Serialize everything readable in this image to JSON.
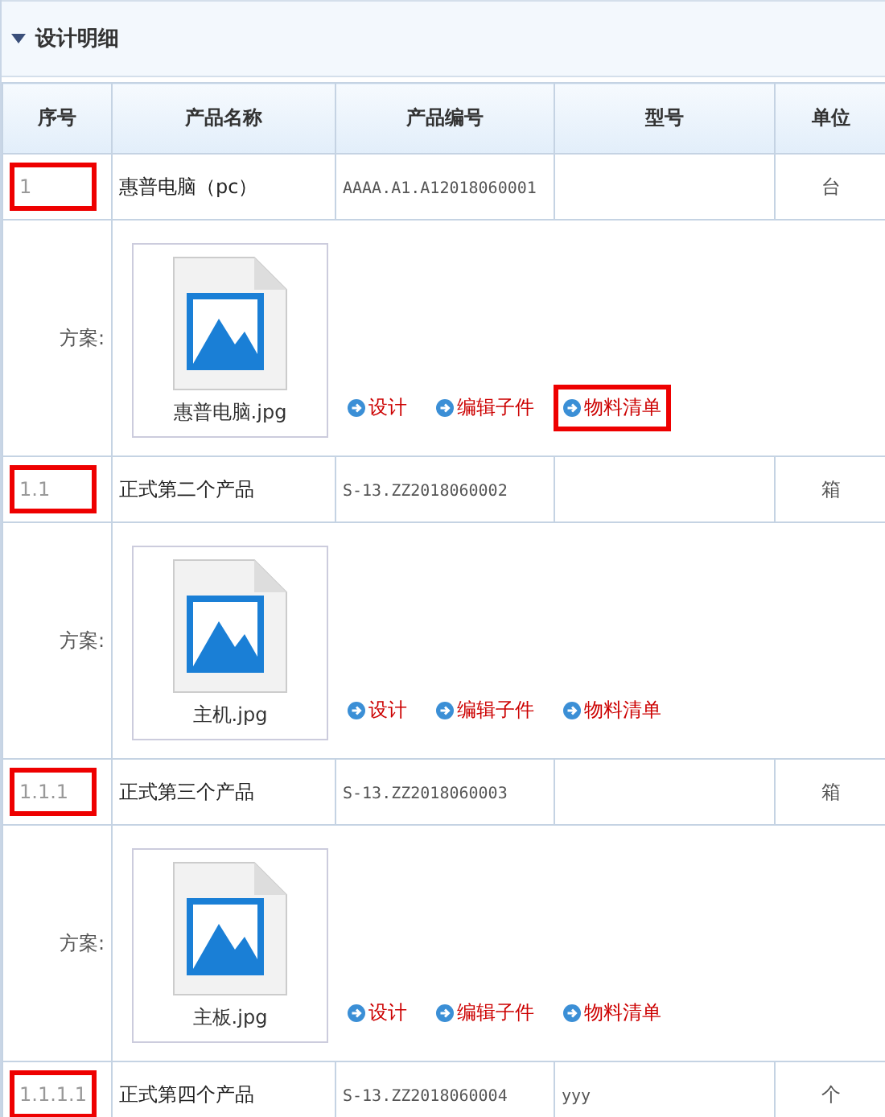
{
  "section": {
    "title": "设计明细",
    "expanded": true
  },
  "columns": [
    "序号",
    "产品名称",
    "产品编号",
    "型号",
    "单位"
  ],
  "rows": [
    {
      "seq": "1",
      "seq_highlighted": true,
      "name": "惠普电脑（pc）",
      "code": "AAAA.A1.A12018060001",
      "model": "",
      "unit": "台",
      "scheme": {
        "label": "方案:",
        "file": "惠普电脑.jpg",
        "actions": [
          {
            "label": "设计",
            "highlighted": false
          },
          {
            "label": "编辑子件",
            "highlighted": false
          },
          {
            "label": "物料清单",
            "highlighted": true
          }
        ]
      }
    },
    {
      "seq": "1.1",
      "seq_highlighted": true,
      "name": "正式第二个产品",
      "code": "S-13.ZZ2018060002",
      "model": "",
      "unit": "箱",
      "scheme": {
        "label": "方案:",
        "file": "主机.jpg",
        "actions": [
          {
            "label": "设计",
            "highlighted": false
          },
          {
            "label": "编辑子件",
            "highlighted": false
          },
          {
            "label": "物料清单",
            "highlighted": false
          }
        ]
      }
    },
    {
      "seq": "1.1.1",
      "seq_highlighted": true,
      "name": "正式第三个产品",
      "code": "S-13.ZZ2018060003",
      "model": "",
      "unit": "箱",
      "scheme": {
        "label": "方案:",
        "file": "主板.jpg",
        "actions": [
          {
            "label": "设计",
            "highlighted": false
          },
          {
            "label": "编辑子件",
            "highlighted": false
          },
          {
            "label": "物料清单",
            "highlighted": false
          }
        ]
      }
    },
    {
      "seq": "1.1.1.1",
      "seq_highlighted": true,
      "name": "正式第四个产品",
      "code": "S-13.ZZ2018060004",
      "model": "yyy",
      "unit": "个"
    }
  ]
}
